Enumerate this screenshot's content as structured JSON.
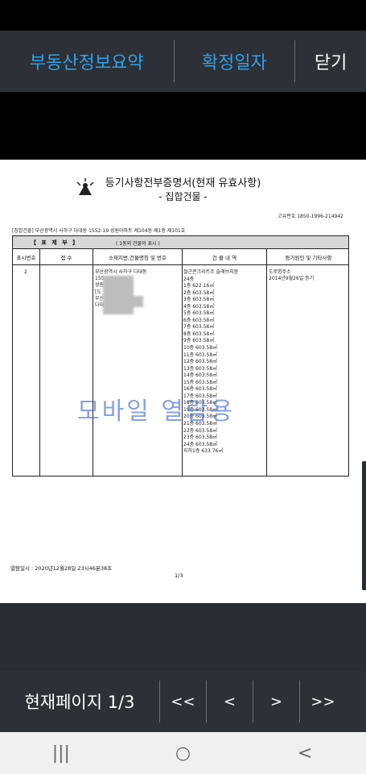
{
  "topbar": {
    "summary_label": "부동산정보요약",
    "confirm_date_label": "확정일자",
    "close_label": "닫기"
  },
  "document": {
    "title": "등기사항전부증명서(현재 유효사항)",
    "subtitle": "- 집합건물 -",
    "serial": "고유번호 1850-1996-214942",
    "property_line": "[집합건물] 부산광역시 사하구 다대동 1552-19 성원아파트 제104동 제1층 제101호",
    "section_name": "【 표 제 부 】",
    "section_note": "( 1동의 건물의 표시 )",
    "columns": [
      "표시번호",
      "접 수",
      "소재지번,건물명칭 및 번호",
      "건 물 내 역",
      "등기원인 및 기타사항"
    ],
    "row_number": "2",
    "address_lines": [
      "부산광역시 사하구 다대동",
      "155",
      "성원",
      "[도",
      "부산",
      "다대"
    ],
    "building_lines": [
      "철근콘크리트조 슬래브지붕",
      "24층",
      "1층 622.16㎡",
      "2층 603.58㎡",
      "3층 603.58㎡",
      "4층 603.58㎡",
      "5층 603.58㎡",
      "6층 603.58㎡",
      "7층 603.58㎡",
      "8층 603.58㎡",
      "9층 603.58㎡",
      "10층 603.58㎡",
      "11층 603.58㎡",
      "12층 603.58㎡",
      "13층 603.58㎡",
      "14층 603.58㎡",
      "15층 603.58㎡",
      "16층 603.58㎡",
      "17층 603.58㎡",
      "18층 603.58㎡",
      "19층 603.58㎡",
      "20층 603.58㎡",
      "21층 603.58㎡",
      "22층 603.58㎡",
      "23층 603.58㎡",
      "24층 603.58㎡",
      "지하1층 633.76㎡"
    ],
    "remark_lines": [
      "도로명주소",
      "2014년9월26일 등기"
    ],
    "watermark": "모바일 열람용",
    "viewed_at": "열람일시 : 2020년12월28일 23시46분38초",
    "page_indicator": "1/3"
  },
  "pager": {
    "label": "현재페이지 1/3",
    "first": "<<",
    "prev": "<",
    "next": ">",
    "last": ">>"
  },
  "navbar": {
    "recent": "|||",
    "home": "○",
    "back": "<"
  }
}
